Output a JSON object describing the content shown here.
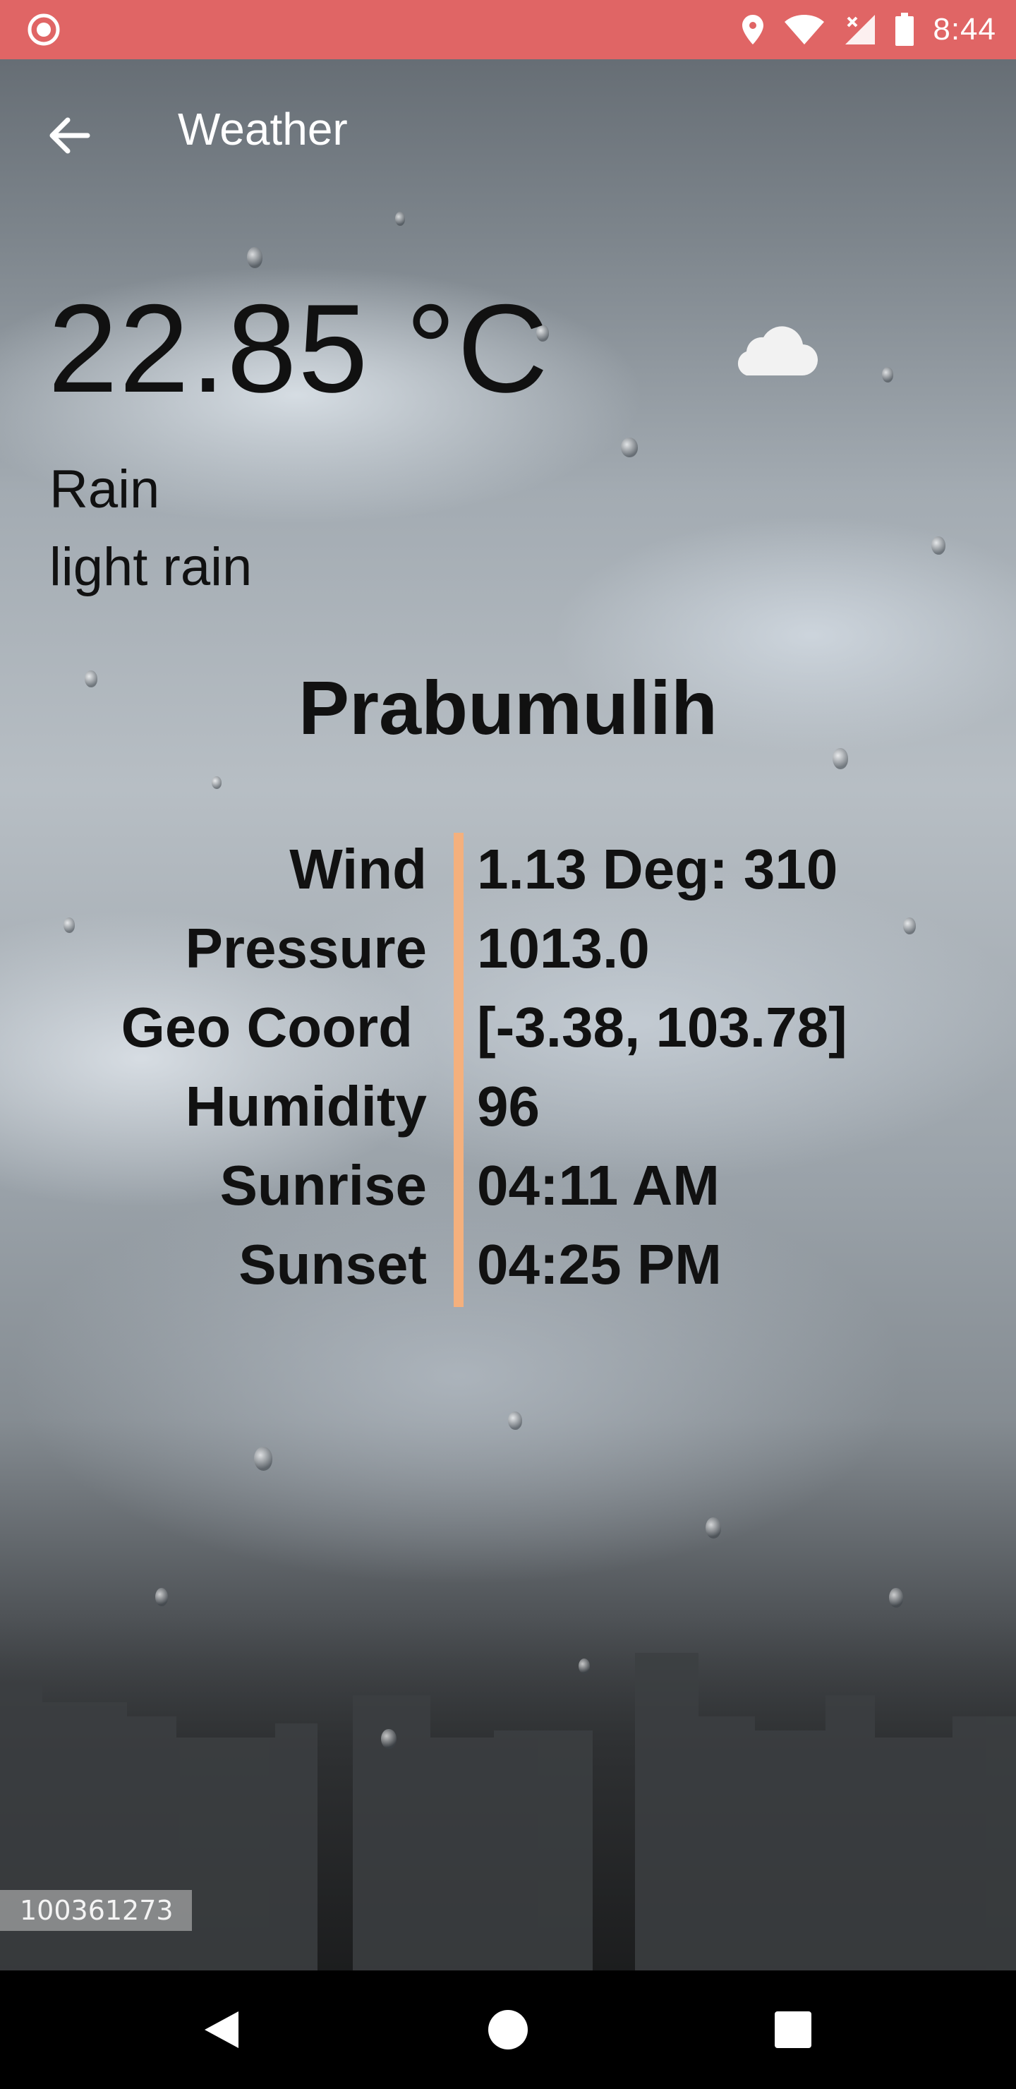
{
  "status_bar": {
    "time": "8:44",
    "icons": [
      "record-icon",
      "location-icon",
      "wifi-icon",
      "signal-off-icon",
      "battery-icon"
    ]
  },
  "toolbar": {
    "title": "Weather",
    "back_icon": "arrow-back-icon"
  },
  "weather": {
    "temperature": "22.85 °C",
    "condition": "Rain",
    "description": "light rain",
    "icon": "cloud-icon",
    "city": "Prabumulih"
  },
  "details": [
    {
      "label": "Wind",
      "value": "1.13 Deg: 310"
    },
    {
      "label": "Pressure",
      "value": "1013.0"
    },
    {
      "label": "Geo Coord",
      "value": "[-3.38, 103.78]"
    },
    {
      "label": "Humidity",
      "value": "96"
    },
    {
      "label": "Sunrise",
      "value": "04:11 AM"
    },
    {
      "label": "Sunset",
      "value": "04:25 PM"
    }
  ],
  "image_id": "100361273",
  "colors": {
    "status_bar": "#e06565",
    "divider": "#f4b07d",
    "text": "#111111"
  },
  "nav_bar": {
    "icons": [
      "back-triangle-icon",
      "home-circle-icon",
      "recents-square-icon"
    ]
  }
}
